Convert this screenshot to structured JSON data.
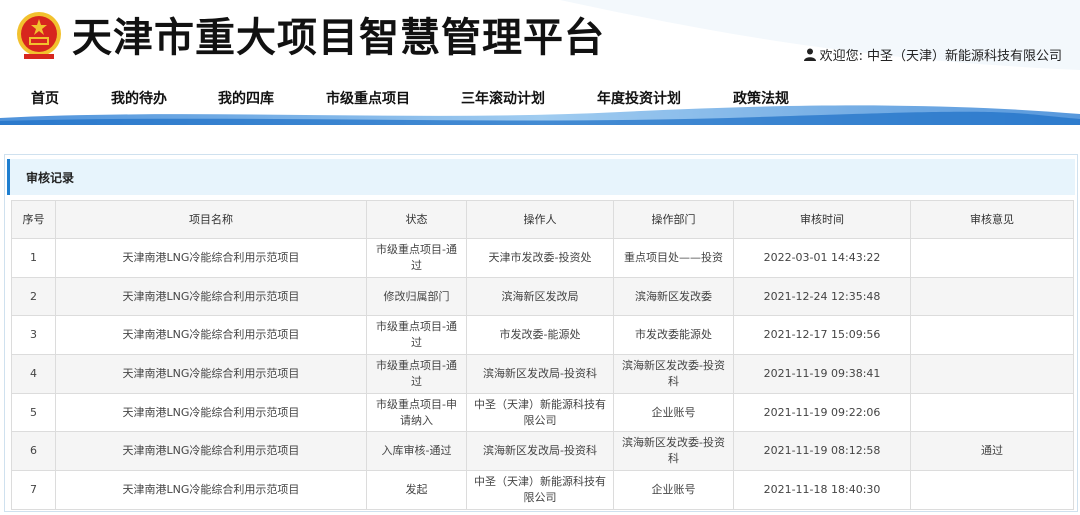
{
  "header": {
    "site_title": "天津市重大项目智慧管理平台",
    "welcome_label": "欢迎您:",
    "user_name": "中圣（天津）新能源科技有限公司"
  },
  "nav": {
    "items": [
      {
        "label": "首页"
      },
      {
        "label": "我的待办"
      },
      {
        "label": "我的四库"
      },
      {
        "label": "市级重点项目"
      },
      {
        "label": "三年滚动计划"
      },
      {
        "label": "年度投资计划"
      },
      {
        "label": "政策法规"
      }
    ]
  },
  "panel": {
    "title": "审核记录"
  },
  "table": {
    "columns": [
      "序号",
      "项目名称",
      "状态",
      "操作人",
      "操作部门",
      "审核时间",
      "审核意见"
    ],
    "rows": [
      {
        "no": "1",
        "project": "天津南港LNG冷能综合利用示范项目",
        "status": "市级重点项目-通过",
        "operator": "天津市发改委-投资处",
        "dept": "重点项目处——投资",
        "time": "2022-03-01 14:43:22",
        "opinion": ""
      },
      {
        "no": "2",
        "project": "天津南港LNG冷能综合利用示范项目",
        "status": "修改归属部门",
        "operator": "滨海新区发改局",
        "dept": "滨海新区发改委",
        "time": "2021-12-24 12:35:48",
        "opinion": ""
      },
      {
        "no": "3",
        "project": "天津南港LNG冷能综合利用示范项目",
        "status": "市级重点项目-通过",
        "operator": "市发改委-能源处",
        "dept": "市发改委能源处",
        "time": "2021-12-17 15:09:56",
        "opinion": ""
      },
      {
        "no": "4",
        "project": "天津南港LNG冷能综合利用示范项目",
        "status": "市级重点项目-通过",
        "operator": "滨海新区发改局-投资科",
        "dept": "滨海新区发改委-投资科",
        "time": "2021-11-19 09:38:41",
        "opinion": ""
      },
      {
        "no": "5",
        "project": "天津南港LNG冷能综合利用示范项目",
        "status": "市级重点项目-申请纳入",
        "operator": "中圣（天津）新能源科技有限公司",
        "dept": "企业账号",
        "time": "2021-11-19 09:22:06",
        "opinion": ""
      },
      {
        "no": "6",
        "project": "天津南港LNG冷能综合利用示范项目",
        "status": "入库审核-通过",
        "operator": "滨海新区发改局-投资科",
        "dept": "滨海新区发改委-投资科",
        "time": "2021-11-19 08:12:58",
        "opinion": "通过"
      },
      {
        "no": "7",
        "project": "天津南港LNG冷能综合利用示范项目",
        "status": "发起",
        "operator": "中圣（天津）新能源科技有限公司",
        "dept": "企业账号",
        "time": "2021-11-18 18:40:30",
        "opinion": ""
      }
    ]
  },
  "colors": {
    "accent": "#1f7fd0",
    "panel_head_bg": "#e7f4fc",
    "emblem_red": "#d7261e",
    "emblem_gold": "#f2c12e"
  },
  "icons": {
    "emblem": "national-emblem-icon",
    "user": "user-icon"
  }
}
